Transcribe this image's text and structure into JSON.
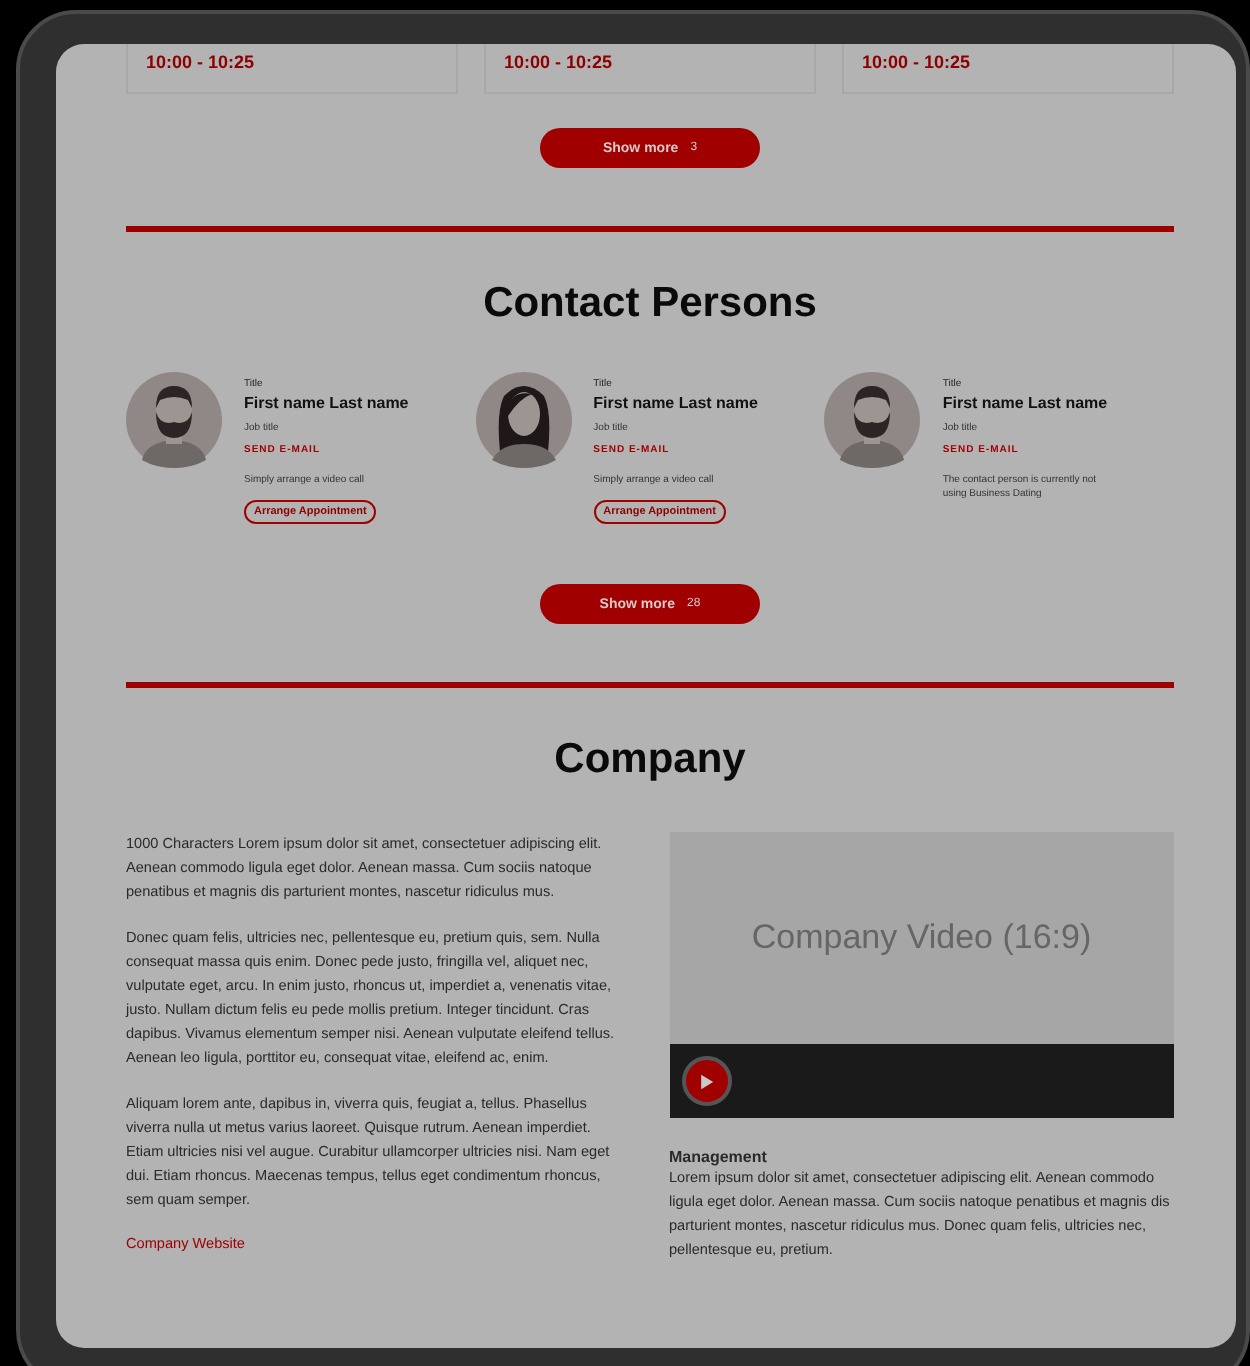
{
  "schedule": {
    "cards": [
      {
        "time": "10:00 - 10:25"
      },
      {
        "time": "10:00 - 10:25"
      },
      {
        "time": "10:00 - 10:25"
      }
    ],
    "show_more": {
      "label": "Show more",
      "count": "3"
    }
  },
  "contact_persons": {
    "title": "Contact Persons",
    "persons": [
      {
        "kind": "man",
        "title": "Title",
        "name": "First name Last name",
        "job_title": "Job title",
        "email_link": "SEND E-MAIL",
        "note": "Simply arrange a video call",
        "button": "Arrange Appointment"
      },
      {
        "kind": "woman",
        "title": "Title",
        "name": "First name Last name",
        "job_title": "Job title",
        "email_link": "SEND E-MAIL",
        "note": "Simply arrange a video call",
        "button": "Arrange Appointment"
      },
      {
        "kind": "man",
        "title": "Title",
        "name": "First name Last name",
        "job_title": "Job title",
        "email_link": "SEND E-MAIL",
        "note": "The contact person is currently not using Business Dating"
      }
    ],
    "show_more": {
      "label": "Show more",
      "count": "28"
    }
  },
  "company": {
    "title": "Company",
    "paragraphs": [
      "1000 Characters Lorem ipsum dolor sit amet, consectetuer adipiscing elit. Aenean commodo ligula eget dolor. Aenean massa. Cum sociis natoque penatibus et magnis dis parturient montes, nascetur ridiculus mus.",
      "Donec quam felis, ultricies nec, pellentesque eu, pretium quis, sem. Nulla consequat massa quis enim. Donec pede justo, fringilla vel, aliquet nec, vulputate eget, arcu. In enim justo, rhoncus ut, imperdiet a, venenatis vitae, justo. Nullam dictum felis eu pede mollis pretium. Integer tincidunt. Cras dapibus. Vivamus elementum semper nisi. Aenean vulputate eleifend tellus. Aenean leo ligula, porttitor eu, consequat vitae, eleifend ac, enim.",
      "Aliquam lorem ante, dapibus in, viverra quis, feugiat a, tellus. Phasellus viverra nulla ut metus varius laoreet. Quisque rutrum. Aenean imperdiet. Etiam ultricies nisi vel augue. Curabitur ullamcorper ultricies nisi. Nam eget dui. Etiam rhoncus. Maecenas tempus, tellus eget condimentum rhoncus, sem quam semper."
    ],
    "website_link": "Company Website",
    "video": {
      "label": "Company Video (16:9)"
    },
    "sections": [
      {
        "heading": "Management",
        "text": "Lorem ipsum dolor sit amet, consectetuer adipiscing elit. Aenean commodo ligula eget dolor. Aenean massa. Cum sociis natoque penatibus et magnis dis parturient montes, nascetur ridiculus mus. Donec quam felis, ultricies nec, pellentesque eu, pretium."
      }
    ]
  }
}
